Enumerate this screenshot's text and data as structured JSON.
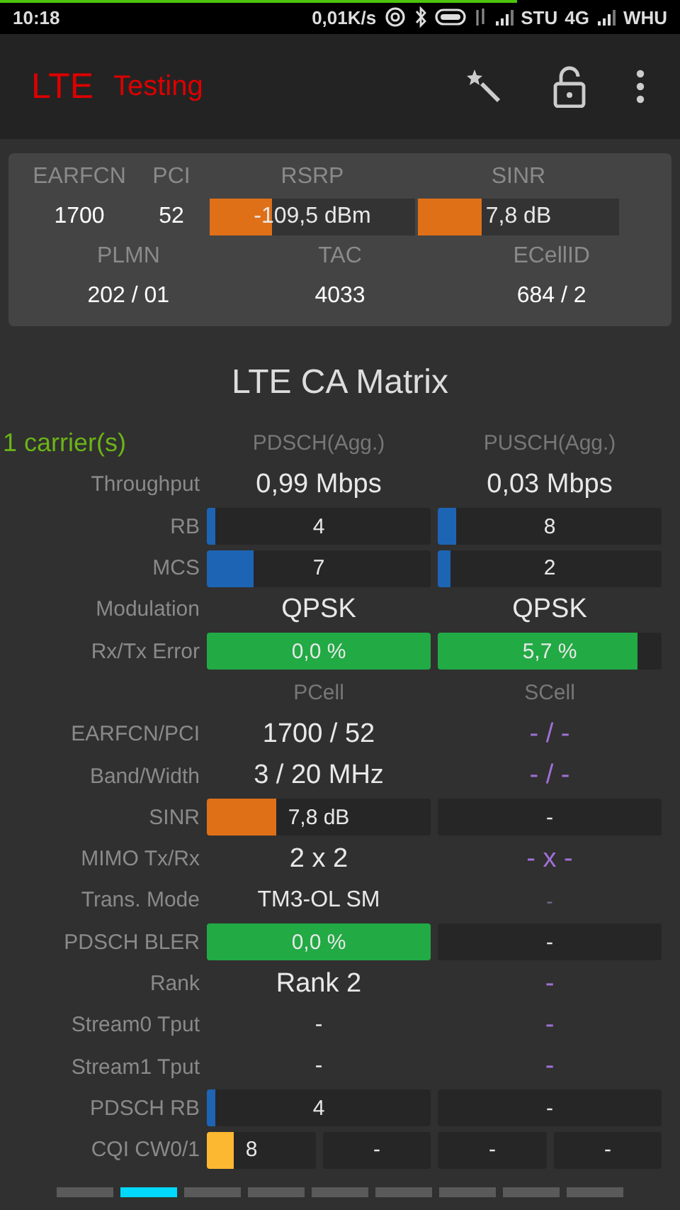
{
  "status_bar": {
    "time": "10:18",
    "speed": "0,01K/s",
    "carrier_1": "STU",
    "network": "4G",
    "carrier_2": "WHU",
    "progress": {
      "level": 0.76
    }
  },
  "app_bar": {
    "title_main": "LTE",
    "title_sub": "Testing"
  },
  "summary": {
    "cells": [
      {
        "label": "EARFCN",
        "value": "1700",
        "kind": "text"
      },
      {
        "label": "PCI",
        "value": "52",
        "kind": "text"
      },
      {
        "label": "RSRP",
        "value": "-109,5 dBm",
        "kind": "bar",
        "level": 0.3,
        "color": "#e07018"
      },
      {
        "label": "SINR",
        "value": "7,8 dB",
        "kind": "bar",
        "level": 0.32,
        "color": "#e07018"
      }
    ],
    "cells_2": [
      {
        "label": "PLMN",
        "value": "202 / 01"
      },
      {
        "label": "TAC",
        "value": "4033"
      },
      {
        "label": "ECellID",
        "value": "684 / 2"
      }
    ]
  },
  "matrix": {
    "title": "LTE CA Matrix",
    "rows": [
      {
        "kind": "header",
        "label": "1 carrier(s)",
        "cells": [
          {
            "kind": "head",
            "text": "PDSCH(Agg.)"
          },
          {
            "kind": "head",
            "text": "PUSCH(Agg.)"
          }
        ]
      },
      {
        "kind": "data",
        "label": "Throughput",
        "cells": [
          {
            "kind": "big",
            "text": "0,99 Mbps"
          },
          {
            "kind": "big",
            "text": "0,03 Mbps"
          }
        ]
      },
      {
        "kind": "data",
        "label": "RB",
        "cells": [
          {
            "kind": "bar",
            "text": "4",
            "level": 0.04,
            "color": "#1e64b4"
          },
          {
            "kind": "bar",
            "text": "8",
            "level": 0.08,
            "color": "#1e64b4"
          }
        ]
      },
      {
        "kind": "data",
        "label": "MCS",
        "cells": [
          {
            "kind": "bar",
            "text": "7",
            "level": 0.21,
            "color": "#1e64b4"
          },
          {
            "kind": "bar",
            "text": "2",
            "level": 0.06,
            "color": "#1e64b4"
          }
        ]
      },
      {
        "kind": "data",
        "label": "Modulation",
        "cells": [
          {
            "kind": "big",
            "text": "QPSK"
          },
          {
            "kind": "big",
            "text": "QPSK"
          }
        ]
      },
      {
        "kind": "data",
        "label": "Rx/Tx Error",
        "cells": [
          {
            "kind": "bar",
            "text": "0,0 %",
            "level": 1,
            "color": "#22aa44"
          },
          {
            "kind": "bar",
            "text": "5,7 %",
            "level": 0.89,
            "color": "#22aa44"
          }
        ]
      },
      {
        "kind": "subheader",
        "label": "",
        "cells": [
          {
            "kind": "head",
            "text": "PCell"
          },
          {
            "kind": "head",
            "text": "SCell"
          }
        ]
      },
      {
        "kind": "data",
        "label": "EARFCN/PCI",
        "cells": [
          {
            "kind": "big",
            "text": "1700 / 52"
          },
          {
            "kind": "dim",
            "text": "- / -"
          }
        ]
      },
      {
        "kind": "data",
        "label": "Band/Width",
        "cells": [
          {
            "kind": "big",
            "text": "3 / 20 MHz"
          },
          {
            "kind": "dim",
            "text": "- / -"
          }
        ]
      },
      {
        "kind": "data",
        "label": "SINR",
        "cells": [
          {
            "kind": "bar",
            "text": "7,8 dB",
            "level": 0.31,
            "color": "#e07018"
          },
          {
            "kind": "bar",
            "text": "-"
          }
        ]
      },
      {
        "kind": "data",
        "label": "MIMO Tx/Rx",
        "cells": [
          {
            "kind": "big",
            "text": "2 x 2"
          },
          {
            "kind": "dim",
            "text": "- x -"
          }
        ]
      },
      {
        "kind": "data",
        "label": "Trans. Mode",
        "cells": [
          {
            "kind": "text",
            "text": "TM3-OL SM"
          },
          {
            "kind": "dimsmall",
            "text": "-"
          }
        ]
      },
      {
        "kind": "data",
        "label": "PDSCH BLER",
        "cells": [
          {
            "kind": "bar",
            "text": "0,0 %",
            "level": 1,
            "color": "#22aa44"
          },
          {
            "kind": "bar",
            "text": "-"
          }
        ]
      },
      {
        "kind": "data",
        "label": "Rank",
        "cells": [
          {
            "kind": "big",
            "text": "Rank 2"
          },
          {
            "kind": "dim",
            "text": "-"
          }
        ]
      },
      {
        "kind": "data",
        "label": "Stream0 Tput",
        "cells": [
          {
            "kind": "text",
            "text": "-"
          },
          {
            "kind": "dim",
            "text": "-"
          }
        ]
      },
      {
        "kind": "data",
        "label": "Stream1 Tput",
        "cells": [
          {
            "kind": "text",
            "text": "-"
          },
          {
            "kind": "dim",
            "text": "-"
          }
        ]
      },
      {
        "kind": "data",
        "label": "PDSCH RB",
        "cells": [
          {
            "kind": "bar",
            "text": "4",
            "level": 0.04,
            "color": "#1e64b4"
          },
          {
            "kind": "bar",
            "text": "-"
          }
        ]
      },
      {
        "kind": "quad",
        "label": "CQI CW0/1",
        "cells": [
          {
            "kind": "bar",
            "text": "8",
            "level": 0.25,
            "color": "#fbb830"
          },
          {
            "kind": "bar",
            "text": "-"
          },
          {
            "kind": "bar",
            "text": "-"
          },
          {
            "kind": "bar",
            "text": "-"
          }
        ]
      }
    ]
  },
  "pages": [
    {
      "selected": false
    },
    {
      "selected": true
    },
    {
      "selected": false
    },
    {
      "selected": false
    },
    {
      "selected": false
    },
    {
      "selected": false
    },
    {
      "selected": false
    },
    {
      "selected": false
    },
    {
      "selected": false
    }
  ]
}
